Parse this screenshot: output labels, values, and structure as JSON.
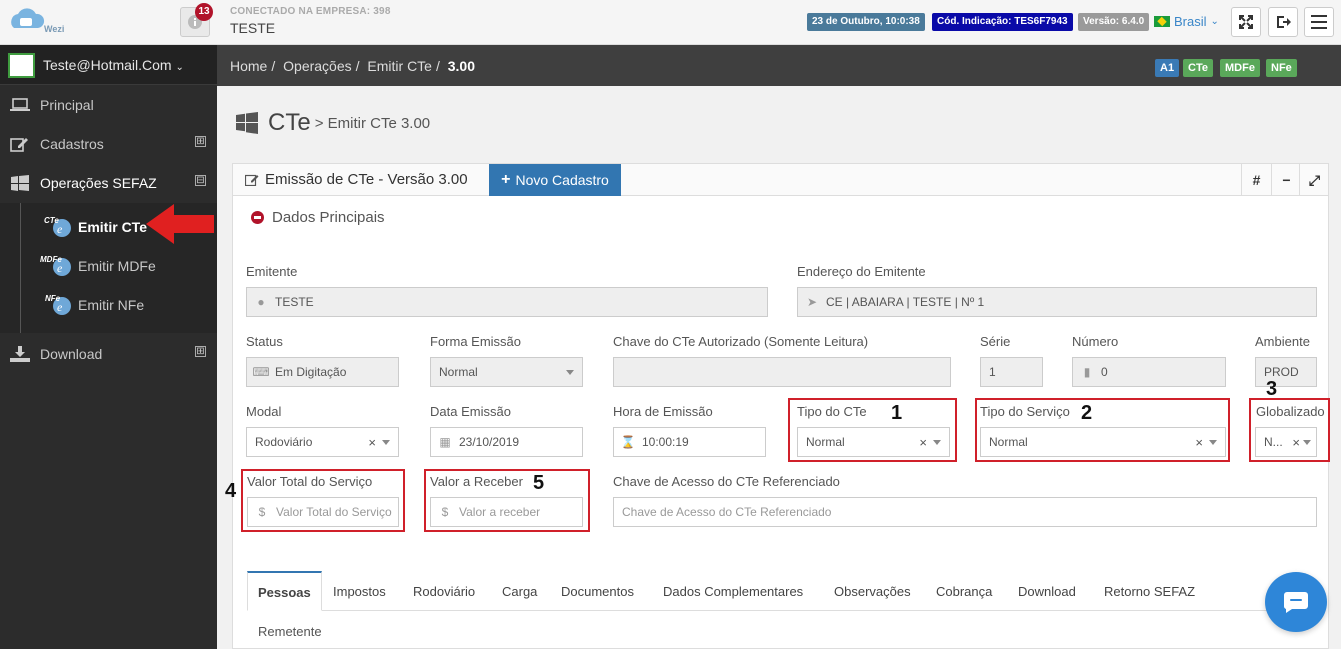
{
  "topbar": {
    "logo_text": "Wezi",
    "notifications_count": "13",
    "connected_label": "CONECTADO NA EMPRESA: 398",
    "company": "TESTE",
    "date_badge": "23 de Outubro, 10:0:38",
    "code_badge": "Cód. Indicação: TES6F7943",
    "version_badge": "Versão: 6.4.0",
    "language": "Brasil",
    "colors": {
      "date": "#4a7a9a",
      "code": "#0a0aa8",
      "version": "#9a9a9a",
      "notif": "#b1132a"
    }
  },
  "sidebar": {
    "user": "Teste@Hotmail.Com",
    "items": [
      {
        "label": "Principal",
        "icon": "laptop-icon"
      },
      {
        "label": "Cadastros",
        "icon": "edit-icon",
        "expand": "⊞"
      },
      {
        "label": "Operações SEFAZ",
        "icon": "windows-icon",
        "expand": "⊟"
      },
      {
        "label": "Download",
        "icon": "download-icon",
        "expand": "⊞"
      }
    ],
    "submenu": [
      {
        "label": "Emitir CTe",
        "icon_tag": "CTe"
      },
      {
        "label": "Emitir MDFe",
        "icon_tag": "MDFe"
      },
      {
        "label": "Emitir NFe",
        "icon_tag": "NFe"
      }
    ]
  },
  "breadcrumb": {
    "items": [
      "Home",
      "Operações",
      "Emitir CTe"
    ],
    "current": "3.00",
    "certs": [
      {
        "label": "A1",
        "color": "#3a7ab5"
      },
      {
        "label": "CTe",
        "color": "#5aa85a"
      },
      {
        "label": "MDFe",
        "color": "#5aa85a"
      },
      {
        "label": "NFe",
        "color": "#5aa85a"
      }
    ]
  },
  "page_header": {
    "title": "CTe",
    "subtitle": "> Emitir CTe 3.00"
  },
  "panel": {
    "title": "Emissão de CTe - Versão 3.00",
    "new_button": "Novo Cadastro",
    "tools": [
      "#",
      "−",
      "⤢"
    ],
    "section": "Dados Principais"
  },
  "form": {
    "emitente_label": "Emitente",
    "emitente_value": "TESTE",
    "endereco_label": "Endereço do Emitente",
    "endereco_value": "CE | ABAIARA | TESTE | Nº 1",
    "status_label": "Status",
    "status_value": "Em Digitação",
    "forma_label": "Forma Emissão",
    "forma_value": "Normal",
    "chave_aut_label": "Chave do CTe Autorizado (Somente Leitura)",
    "chave_aut_value": "",
    "serie_label": "Série",
    "serie_value": "1",
    "numero_label": "Número",
    "numero_value": "0",
    "ambiente_label": "Ambiente",
    "ambiente_value": "PROD",
    "modal_label": "Modal",
    "modal_value": "Rodoviário",
    "data_label": "Data Emissão",
    "data_value": "23/10/2019",
    "hora_label": "Hora de Emissão",
    "hora_value": "10:00:19",
    "tipo_cte_label": "Tipo do CTe",
    "tipo_cte_value": "Normal",
    "tipo_serv_label": "Tipo do Serviço",
    "tipo_serv_value": "Normal",
    "glob_label": "Globalizado",
    "glob_value": "N...",
    "valor_total_label": "Valor Total do Serviço",
    "valor_total_placeholder": "Valor Total do Serviço",
    "valor_receber_label": "Valor a Receber",
    "valor_receber_placeholder": "Valor a receber",
    "chave_ref_label": "Chave de Acesso do CTe Referenciado",
    "chave_ref_placeholder": "Chave de Acesso do CTe Referenciado"
  },
  "markers": [
    "1",
    "2",
    "3",
    "4",
    "5"
  ],
  "tabs": [
    "Pessoas",
    "Impostos",
    "Rodoviário",
    "Carga",
    "Documentos",
    "Dados Complementares",
    "Observações",
    "Cobrança",
    "Download",
    "Retorno SEFAZ"
  ],
  "remetente_label": "Remetente"
}
